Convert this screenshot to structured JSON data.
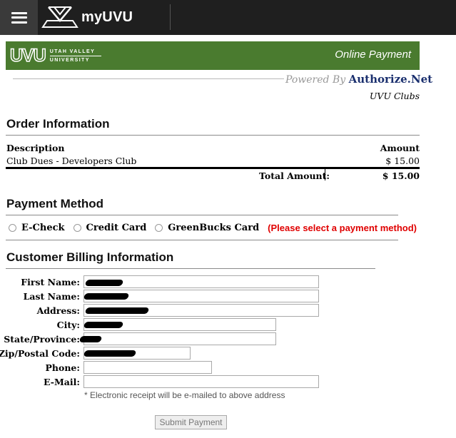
{
  "app": {
    "brand": "myUVU",
    "menu_icon": "hamburger-icon",
    "logo_icon": "myuvu-logo-icon"
  },
  "banner": {
    "logo_mark": "UVU",
    "logo_line1": "UTAH VALLEY",
    "logo_line2": "UNIVERSITY",
    "title": "Online Payment",
    "colors": {
      "banner_green": "#4a7b2f"
    }
  },
  "powered_by": {
    "prefix": "Powered By",
    "brand": "Authorize.Net"
  },
  "merchant": "UVU Clubs",
  "order": {
    "heading": "Order Information",
    "col_description": "Description",
    "col_amount": "Amount",
    "items": [
      {
        "description": "Club Dues - Developers Club",
        "amount": "$ 15.00"
      }
    ],
    "total_label": "Total Amount:",
    "total_value": "$ 15.00"
  },
  "payment": {
    "heading": "Payment Method",
    "options": [
      "E-Check",
      "Credit Card",
      "GreenBucks Card"
    ],
    "selected": null,
    "warning": "(Please select a payment method)",
    "warning_color": "#e00000"
  },
  "billing": {
    "heading": "Customer Billing Information",
    "fields": [
      {
        "label": "First Name:",
        "value": "",
        "redacted": true
      },
      {
        "label": "Last Name:",
        "value": "",
        "redacted": true
      },
      {
        "label": "Address:",
        "value": "",
        "redacted": true
      },
      {
        "label": "City:",
        "value": "",
        "redacted": true
      },
      {
        "label": "State/Province:",
        "value": "",
        "redacted": true
      },
      {
        "label": "Zip/Postal Code:",
        "value": "",
        "redacted": true
      },
      {
        "label": "Phone:",
        "value": "",
        "redacted": false
      },
      {
        "label": "E-Mail:",
        "value": "",
        "redacted": false
      }
    ],
    "note": "* Electronic receipt will be e-mailed to above address",
    "submit_label": "Submit Payment"
  }
}
